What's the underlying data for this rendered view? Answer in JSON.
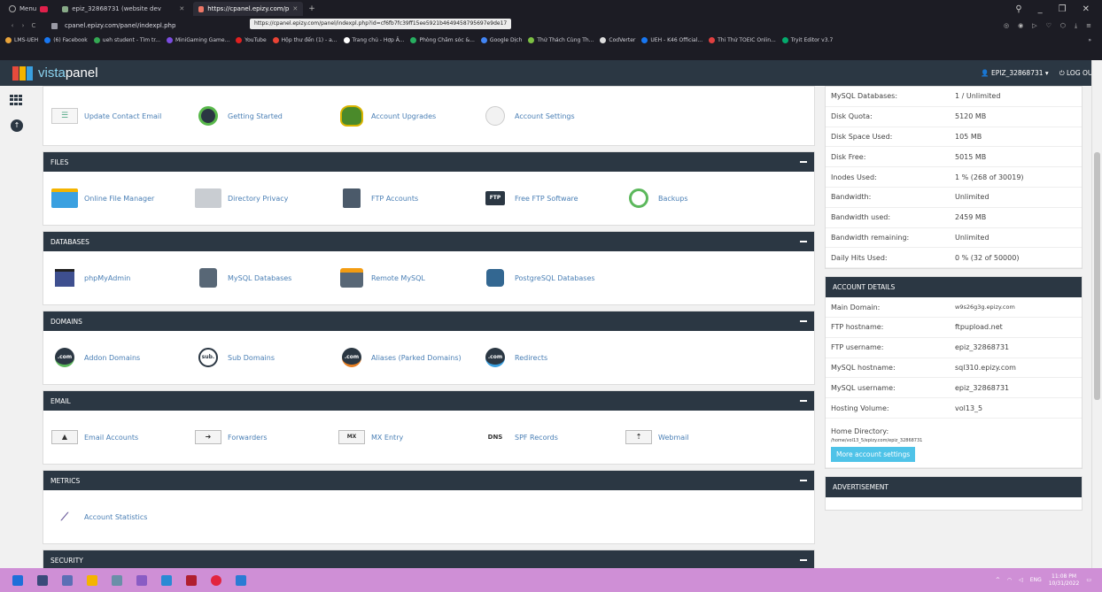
{
  "browser": {
    "menu_label": "Menu",
    "tabs": [
      {
        "label": "epiz_32868731 (website dev"
      },
      {
        "label": "https://cpanel.epizy.com/p"
      }
    ],
    "tooltip": "https://cpanel.epizy.com/panel/indexpl.php?id=cf6fb7fc39ff15ee5921b4649458795697e9de17",
    "url": "cpanel.epizy.com/panel/indexpl.php",
    "bookmarks": [
      {
        "label": "LMS-UEH",
        "color": "#e8a33a"
      },
      {
        "label": "(6) Facebook",
        "color": "#1877f2"
      },
      {
        "label": "ueh student - Tìm tr...",
        "color": "#34a853"
      },
      {
        "label": "MiniGaming Game...",
        "color": "#7b4ce0"
      },
      {
        "label": "YouTube",
        "color": "#e02020"
      },
      {
        "label": "Hộp thư đến (1) - a...",
        "color": "#ea4335"
      },
      {
        "label": "Trang chủ - Hợp Â...",
        "color": "#ffffff"
      },
      {
        "label": "Phòng Chăm sóc &...",
        "color": "#27ae60"
      },
      {
        "label": "Google Dịch",
        "color": "#4285f4"
      },
      {
        "label": "Thử Thách Cùng Th...",
        "color": "#7cc043"
      },
      {
        "label": "CodVerter",
        "color": "#dddddd"
      },
      {
        "label": "UEH - K46 Official...",
        "color": "#1877f2"
      },
      {
        "label": "Thi Thử TOEIC Onlin...",
        "color": "#e04040"
      },
      {
        "label": "Tryit Editor v3.7",
        "color": "#04aa6d"
      }
    ],
    "bookmarks_more": "»"
  },
  "header": {
    "logo_a": "vista",
    "logo_b": "panel",
    "user": "EPIZ_32868731",
    "logout": "LOG OUT"
  },
  "sections": [
    {
      "title": "",
      "items": [
        {
          "label": "Update Contact Email",
          "icon": "contact-email-icon"
        },
        {
          "label": "Getting Started",
          "icon": "getting-started-icon"
        },
        {
          "label": "Account Upgrades",
          "icon": "account-upgrades-icon"
        },
        {
          "label": "Account Settings",
          "icon": "account-settings-icon"
        }
      ]
    },
    {
      "title": "FILES",
      "items": [
        {
          "label": "Online File Manager",
          "icon": "file-manager-icon"
        },
        {
          "label": "Directory Privacy",
          "icon": "directory-privacy-icon"
        },
        {
          "label": "FTP Accounts",
          "icon": "ftp-accounts-icon"
        },
        {
          "label": "Free FTP Software",
          "icon": "ftp-software-icon"
        },
        {
          "label": "Backups",
          "icon": "backups-icon"
        }
      ]
    },
    {
      "title": "DATABASES",
      "items": [
        {
          "label": "phpMyAdmin",
          "icon": "phpmyadmin-icon"
        },
        {
          "label": "MySQL Databases",
          "icon": "mysql-icon"
        },
        {
          "label": "Remote MySQL",
          "icon": "remote-mysql-icon"
        },
        {
          "label": "PostgreSQL Databases",
          "icon": "postgresql-icon"
        }
      ]
    },
    {
      "title": "DOMAINS",
      "items": [
        {
          "label": "Addon Domains",
          "icon": "addon-domains-icon"
        },
        {
          "label": "Sub Domains",
          "icon": "sub-domains-icon"
        },
        {
          "label": "Aliases (Parked Domains)",
          "icon": "aliases-icon"
        },
        {
          "label": "Redirects",
          "icon": "redirects-icon"
        }
      ]
    },
    {
      "title": "EMAIL",
      "items": [
        {
          "label": "Email Accounts",
          "icon": "email-accounts-icon"
        },
        {
          "label": "Forwarders",
          "icon": "forwarders-icon"
        },
        {
          "label": "MX Entry",
          "icon": "mx-entry-icon"
        },
        {
          "label": "SPF Records",
          "icon": "spf-records-icon"
        },
        {
          "label": "Webmail",
          "icon": "webmail-icon"
        }
      ]
    },
    {
      "title": "METRICS",
      "items": [
        {
          "label": "Account Statistics",
          "icon": "account-statistics-icon"
        }
      ]
    },
    {
      "title": "SECURITY",
      "items": []
    }
  ],
  "icon_text": {
    "ftp": "FTP",
    "com": ".com",
    "sub": "sub.",
    "mx": "MX",
    "dns": "DNS"
  },
  "stats": [
    {
      "k": "MySQL Databases:",
      "v": "1 / Unlimited"
    },
    {
      "k": "Disk Quota:",
      "v": "5120 MB"
    },
    {
      "k": "Disk Space Used:",
      "v": "105 MB"
    },
    {
      "k": "Disk Free:",
      "v": "5015 MB"
    },
    {
      "k": "Inodes Used:",
      "v": "1 % (268 of 30019)"
    },
    {
      "k": "Bandwidth:",
      "v": "Unlimited"
    },
    {
      "k": "Bandwidth used:",
      "v": "2459 MB"
    },
    {
      "k": "Bandwidth remaining:",
      "v": "Unlimited"
    },
    {
      "k": "Daily Hits Used:",
      "v": "0 % (32 of 50000)"
    }
  ],
  "account": {
    "title": "ACCOUNT DETAILS",
    "rows": [
      {
        "k": "Main Domain:",
        "v": "w9s26g3g.epizy.com"
      },
      {
        "k": "FTP hostname:",
        "v": "ftpupload.net"
      },
      {
        "k": "FTP username:",
        "v": "epiz_32868731"
      },
      {
        "k": "MySQL hostname:",
        "v": "sql310.epizy.com"
      },
      {
        "k": "MySQL username:",
        "v": "epiz_32868731"
      },
      {
        "k": "Hosting Volume:",
        "v": "vol13_5"
      }
    ],
    "home_k": "Home Directory:",
    "home_v": "/home/vol13_5/epizy.com/epiz_32868731",
    "more_btn": "More account settings"
  },
  "ad": {
    "title": "ADVERTISEMENT"
  },
  "taskbar": {
    "lang": "ENG",
    "time": "11:08 PM",
    "date": "10/31/2022"
  }
}
